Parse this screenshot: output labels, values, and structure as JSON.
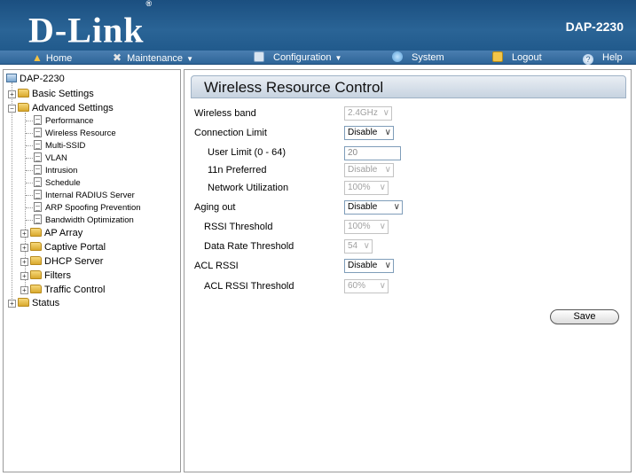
{
  "header": {
    "brand": "D-Link",
    "registered": "®",
    "model": "DAP-2230"
  },
  "menu": {
    "home": "Home",
    "maintenance": "Maintenance",
    "configuration": "Configuration",
    "system": "System",
    "logout": "Logout",
    "help": "Help"
  },
  "colors": {
    "header_bg": "#2a6496",
    "menubar_bg": "#3a72a6",
    "panel_title_bg": "#d4deea"
  },
  "sidebar": {
    "root": "DAP-2230",
    "basic_settings": "Basic Settings",
    "advanced_settings": "Advanced Settings",
    "children": [
      "Performance",
      "Wireless Resource",
      "Multi-SSID",
      "VLAN",
      "Intrusion",
      "Schedule",
      "Internal RADIUS Server",
      "ARP Spoofing Prevention",
      "Bandwidth Optimization"
    ],
    "folders": [
      "AP Array",
      "Captive Portal",
      "DHCP Server",
      "Filters",
      "Traffic Control"
    ],
    "status": "Status"
  },
  "content": {
    "title": "Wireless Resource Control",
    "fields": {
      "wireless_band": {
        "label": "Wireless band",
        "value": "2.4GHz"
      },
      "connection_limit": {
        "label": "Connection Limit",
        "value": "Disable"
      },
      "user_limit": {
        "label": "User Limit (0 - 64)",
        "value": "20"
      },
      "n11_preferred": {
        "label": "11n Preferred",
        "value": "Disable"
      },
      "network_utilization": {
        "label": "Network Utilization",
        "value": "100%"
      },
      "aging_out": {
        "label": "Aging out",
        "value": "Disable"
      },
      "rssi_threshold": {
        "label": "RSSI Threshold",
        "value": "100%"
      },
      "data_rate_threshold": {
        "label": "Data Rate Threshold",
        "value": "54"
      },
      "acl_rssi": {
        "label": "ACL RSSI",
        "value": "Disable"
      },
      "acl_rssi_threshold": {
        "label": "ACL RSSI Threshold",
        "value": "60%"
      }
    },
    "save_label": "Save"
  }
}
